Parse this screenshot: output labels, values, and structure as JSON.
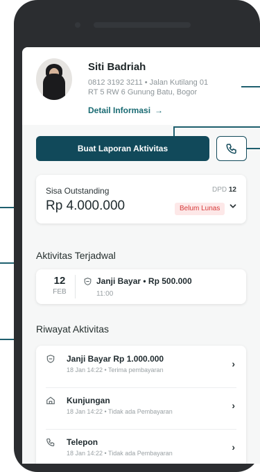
{
  "profile": {
    "name": "Siti Badriah",
    "contact_line1": "0812 3192 3211 • Jalan Kutilang 01",
    "contact_line2": "RT 5 RW 6 Gunung Batu, Bogor",
    "detail_link": "Detail Informasi",
    "avatar_icon": "avatar-photo"
  },
  "actions": {
    "primary_label": "Buat Laporan Aktivitas",
    "call_icon": "phone-icon"
  },
  "outstanding": {
    "title": "Sisa Outstanding",
    "dpd_label": "DPD",
    "dpd_value": "12",
    "amount": "Rp 4.000.000",
    "status_badge": "Belum Lunas"
  },
  "scheduled": {
    "title": "Aktivitas Terjadwal",
    "day": "12",
    "month": "FEB",
    "activity": "Janji Bayar • Rp 500.000",
    "time": "11:00"
  },
  "history": {
    "title": "Riwayat Aktivitas",
    "items": [
      {
        "icon": "promise-icon",
        "title": "Janji Bayar Rp 1.000.000",
        "subtitle": "18 Jan 14:22 • Terima pembayaran"
      },
      {
        "icon": "home-icon",
        "title": "Kunjungan",
        "subtitle": "18 Jan 14:22 • Tidak ada Pembayaran"
      },
      {
        "icon": "phone-icon",
        "title": "Telepon",
        "subtitle": "18 Jan 14:22 • Tidak ada Pembayaran"
      }
    ]
  },
  "colors": {
    "primary": "#11495a",
    "link": "#1a6b73",
    "danger": "#d63a3a",
    "annotation": "#1e5f6e"
  }
}
